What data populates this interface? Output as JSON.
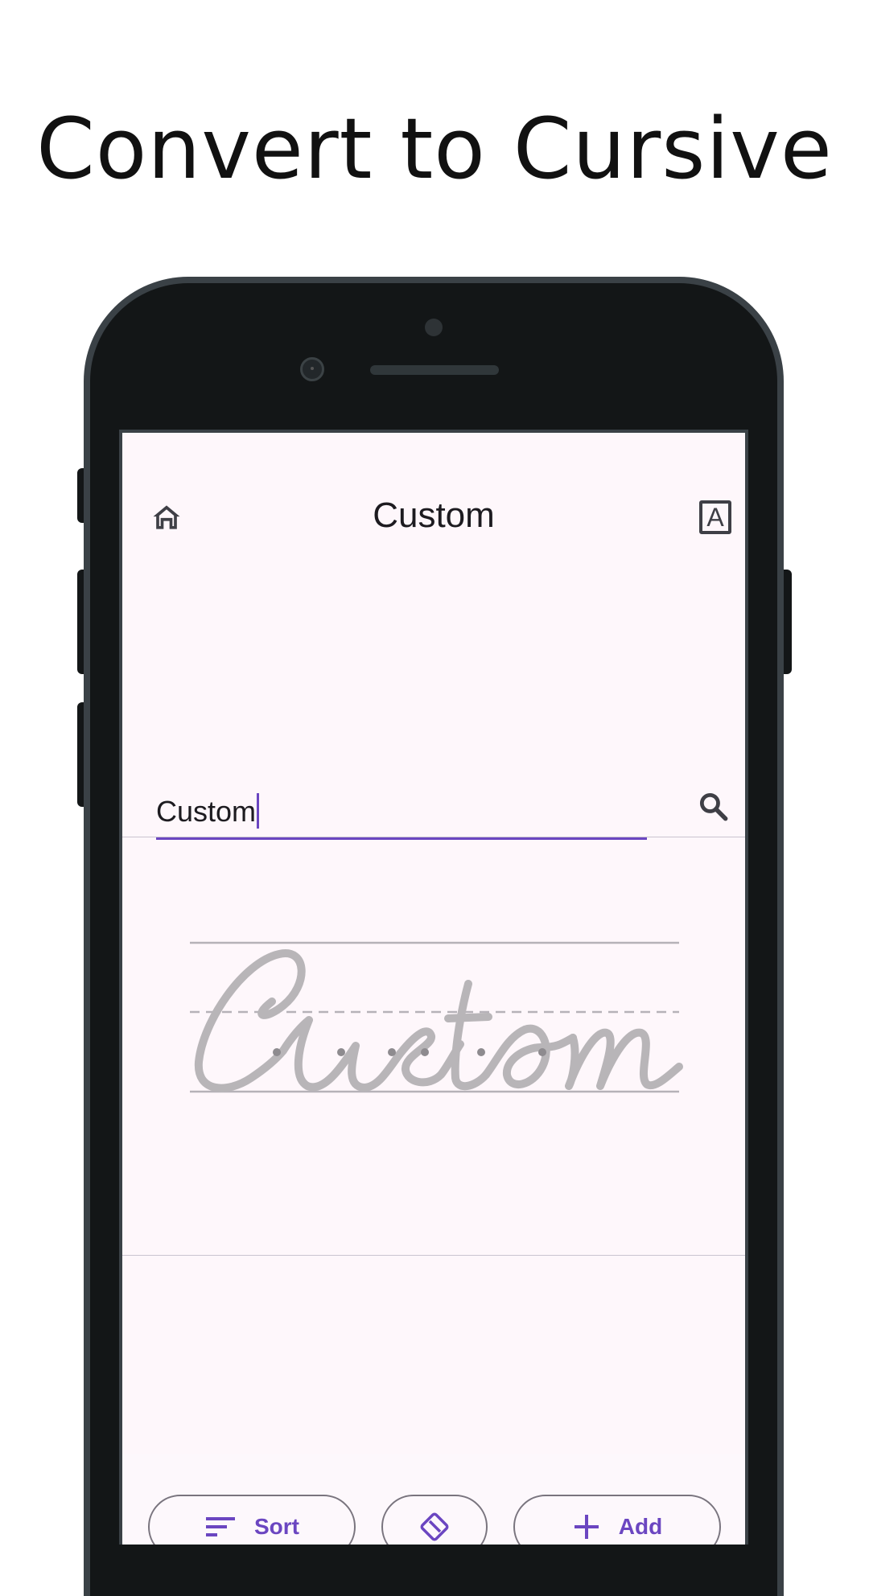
{
  "headline": "Convert to Cursive",
  "appbar": {
    "title": "Custom",
    "home_icon": "home-icon",
    "font_icon": "font-icon",
    "font_letter": "A"
  },
  "input": {
    "value": "Custom",
    "search_icon": "search-icon"
  },
  "preview": {
    "cursive_text": "Custom"
  },
  "actions": {
    "sort_label": "Sort",
    "add_label": "Add",
    "erase_icon": "eraser-icon"
  },
  "colors": {
    "accent": "#6b46c1",
    "screen_bg": "#fef7fb",
    "phone_body": "#131617",
    "trace_gray": "#b8b5b8"
  }
}
